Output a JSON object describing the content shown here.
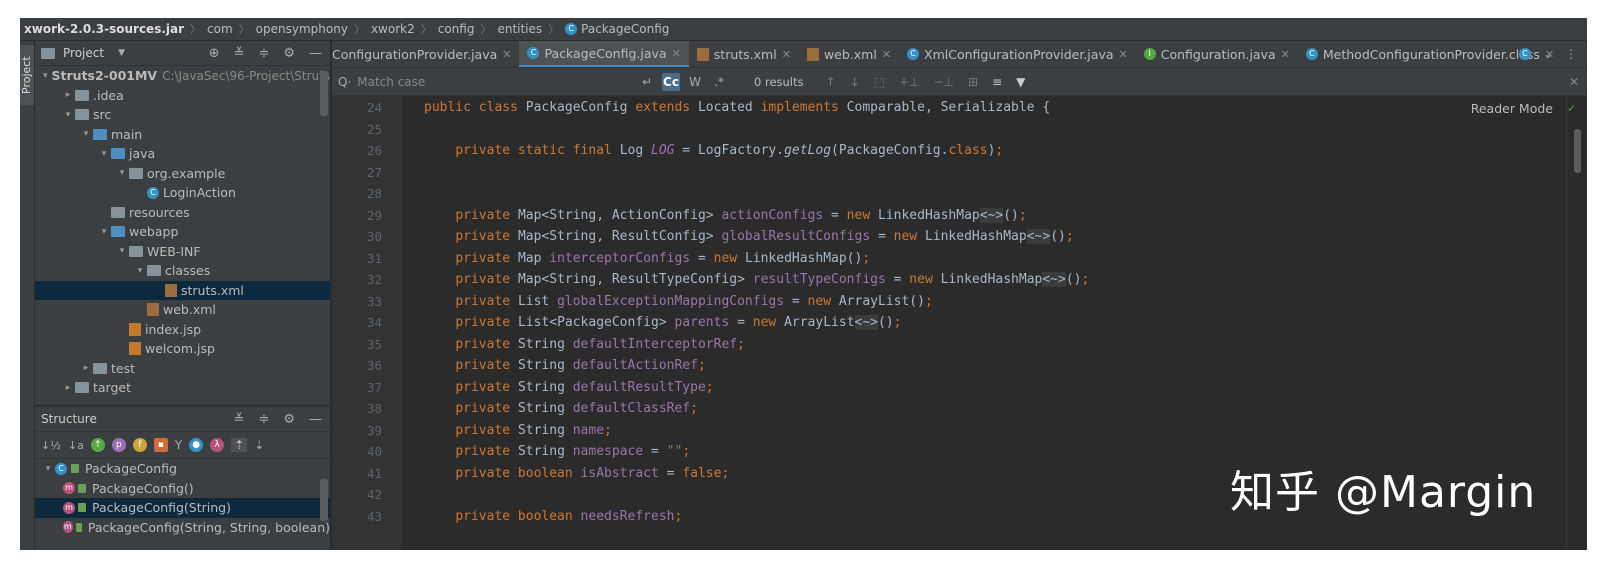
{
  "breadcrumb": [
    "xwork-2.0.3-sources.jar",
    "com",
    "opensymphony",
    "xwork2",
    "config",
    "entities",
    "PackageConfig"
  ],
  "sidebar_strip_label": "Project",
  "project_panel": {
    "title": "Project",
    "tree": [
      {
        "label": "Struts2-001MV",
        "path": "C:\\JavaSec\\96-Project\\Struts",
        "depth": 0,
        "arrow": "▾",
        "icon": "folder",
        "bold": true
      },
      {
        "label": ".idea",
        "depth": 1,
        "arrow": "▸",
        "icon": "folder"
      },
      {
        "label": "src",
        "depth": 1,
        "arrow": "▾",
        "icon": "folder"
      },
      {
        "label": "main",
        "depth": 2,
        "arrow": "▾",
        "icon": "bluefolder"
      },
      {
        "label": "java",
        "depth": 3,
        "arrow": "▾",
        "icon": "bluefolder"
      },
      {
        "label": "org.example",
        "depth": 4,
        "arrow": "▾",
        "icon": "folder"
      },
      {
        "label": "LoginAction",
        "depth": 5,
        "arrow": "",
        "icon": "cls"
      },
      {
        "label": "resources",
        "depth": 3,
        "arrow": "",
        "icon": "folder"
      },
      {
        "label": "webapp",
        "depth": 3,
        "arrow": "▾",
        "icon": "bluefolder"
      },
      {
        "label": "WEB-INF",
        "depth": 4,
        "arrow": "▾",
        "icon": "folder"
      },
      {
        "label": "classes",
        "depth": 5,
        "arrow": "▾",
        "icon": "folder"
      },
      {
        "label": "struts.xml",
        "depth": 6,
        "arrow": "",
        "icon": "xml",
        "selected": true
      },
      {
        "label": "web.xml",
        "depth": 5,
        "arrow": "",
        "icon": "xml"
      },
      {
        "label": "index.jsp",
        "depth": 4,
        "arrow": "",
        "icon": "jsp"
      },
      {
        "label": "welcom.jsp",
        "depth": 4,
        "arrow": "",
        "icon": "jsp"
      },
      {
        "label": "test",
        "depth": 2,
        "arrow": "▸",
        "icon": "folder"
      },
      {
        "label": "target",
        "depth": 1,
        "arrow": "▸",
        "icon": "folder"
      }
    ]
  },
  "structure_panel": {
    "title": "Structure",
    "items": [
      {
        "label": "PackageConfig",
        "kind": "class",
        "depth": 0
      },
      {
        "label": "PackageConfig()",
        "kind": "method",
        "depth": 1
      },
      {
        "label": "PackageConfig(String)",
        "kind": "method",
        "depth": 1,
        "selected": true
      },
      {
        "label": "PackageConfig(String, String, boolean)",
        "kind": "method",
        "depth": 1
      }
    ]
  },
  "editor": {
    "tabs": [
      {
        "label": "ConfigurationProvider.java",
        "icon": "cls"
      },
      {
        "label": "PackageConfig.java",
        "icon": "cls",
        "active": true
      },
      {
        "label": "struts.xml",
        "icon": "xml"
      },
      {
        "label": "web.xml",
        "icon": "xml"
      },
      {
        "label": "XmlConfigurationProvider.java",
        "icon": "cls"
      },
      {
        "label": "Configuration.java",
        "icon": "green"
      },
      {
        "label": "MethodConfigurationProvider.class",
        "icon": "cls"
      }
    ],
    "find": {
      "placeholder": "Match case",
      "results": "0 results",
      "case_label": "Cc",
      "word_label": "W",
      "regex_label": ".*"
    },
    "reader_mode": "Reader Mode",
    "lines": [
      {
        "n": "24",
        "html": "<span class=\"kw\">public class </span>PackageConfig <span class=\"kw\">extends </span>Located <span class=\"kw\">implements </span>Comparable, Serializable {"
      },
      {
        "n": "25",
        "html": ""
      },
      {
        "n": "26",
        "html": "    <span class=\"kw\">private static final </span>Log <span class=\"sfld\">LOG</span> = LogFactory.<span class=\"mth\">getLog</span>(PackageConfig.<span class=\"kw\">class</span>)<span class=\"kw\">;</span>"
      },
      {
        "n": "27",
        "html": ""
      },
      {
        "n": "28",
        "html": ""
      },
      {
        "n": "29",
        "html": "    <span class=\"kw\">private </span>Map&lt;String, ActionConfig&gt; <span class=\"fld\">actionConfigs</span> = <span class=\"kw\">new </span>LinkedHashMap<span class=\"dia\">&lt;~&gt;</span>()<span class=\"kw\">;</span>"
      },
      {
        "n": "30",
        "html": "    <span class=\"kw\">private </span>Map&lt;String, ResultConfig&gt; <span class=\"fld\">globalResultConfigs</span> = <span class=\"kw\">new </span>LinkedHashMap<span class=\"dia\">&lt;~&gt;</span>()<span class=\"kw\">;</span>"
      },
      {
        "n": "31",
        "html": "    <span class=\"kw\">private </span>Map <span class=\"fld\">interceptorConfigs</span> = <span class=\"kw\">new </span>LinkedHashMap()<span class=\"kw\">;</span>"
      },
      {
        "n": "32",
        "html": "    <span class=\"kw\">private </span>Map&lt;String, ResultTypeConfig&gt; <span class=\"fld\">resultTypeConfigs</span> = <span class=\"kw\">new </span>LinkedHashMap<span class=\"dia\">&lt;~&gt;</span>()<span class=\"kw\">;</span>"
      },
      {
        "n": "33",
        "html": "    <span class=\"kw\">private </span>List <span class=\"fld\">globalExceptionMappingConfigs</span> = <span class=\"kw\">new </span>ArrayList()<span class=\"kw\">;</span>"
      },
      {
        "n": "34",
        "html": "    <span class=\"kw\">private </span>List&lt;PackageConfig&gt; <span class=\"fld\">parents</span> = <span class=\"kw\">new </span>ArrayList<span class=\"dia\">&lt;~&gt;</span>()<span class=\"kw\">;</span>"
      },
      {
        "n": "35",
        "html": "    <span class=\"kw\">private </span>String <span class=\"fld\">defaultInterceptorRef</span><span class=\"kw\">;</span>"
      },
      {
        "n": "36",
        "html": "    <span class=\"kw\">private </span>String <span class=\"fld\">defaultActionRef</span><span class=\"kw\">;</span>"
      },
      {
        "n": "37",
        "html": "    <span class=\"kw\">private </span>String <span class=\"fld\">defaultResultType</span><span class=\"kw\">;</span>"
      },
      {
        "n": "38",
        "html": "    <span class=\"kw\">private </span>String <span class=\"fld\">defaultClassRef</span><span class=\"kw\">;</span>"
      },
      {
        "n": "39",
        "html": "    <span class=\"kw\">private </span>String <span class=\"fld\">name</span><span class=\"kw\">;</span>"
      },
      {
        "n": "40",
        "html": "    <span class=\"kw\">private </span>String <span class=\"fld\">namespace</span> = <span class=\"str\">\"\"</span><span class=\"kw\">;</span>"
      },
      {
        "n": "41",
        "html": "    <span class=\"kw\">private boolean </span><span class=\"fld\">isAbstract</span> = <span class=\"kw\">false;</span>"
      },
      {
        "n": "42",
        "html": ""
      },
      {
        "n": "43",
        "html": "    <span class=\"kw\">private boolean </span><span class=\"fld\">needsRefresh</span><span class=\"kw\">;</span>"
      }
    ]
  },
  "watermark": "知乎 @Margin"
}
